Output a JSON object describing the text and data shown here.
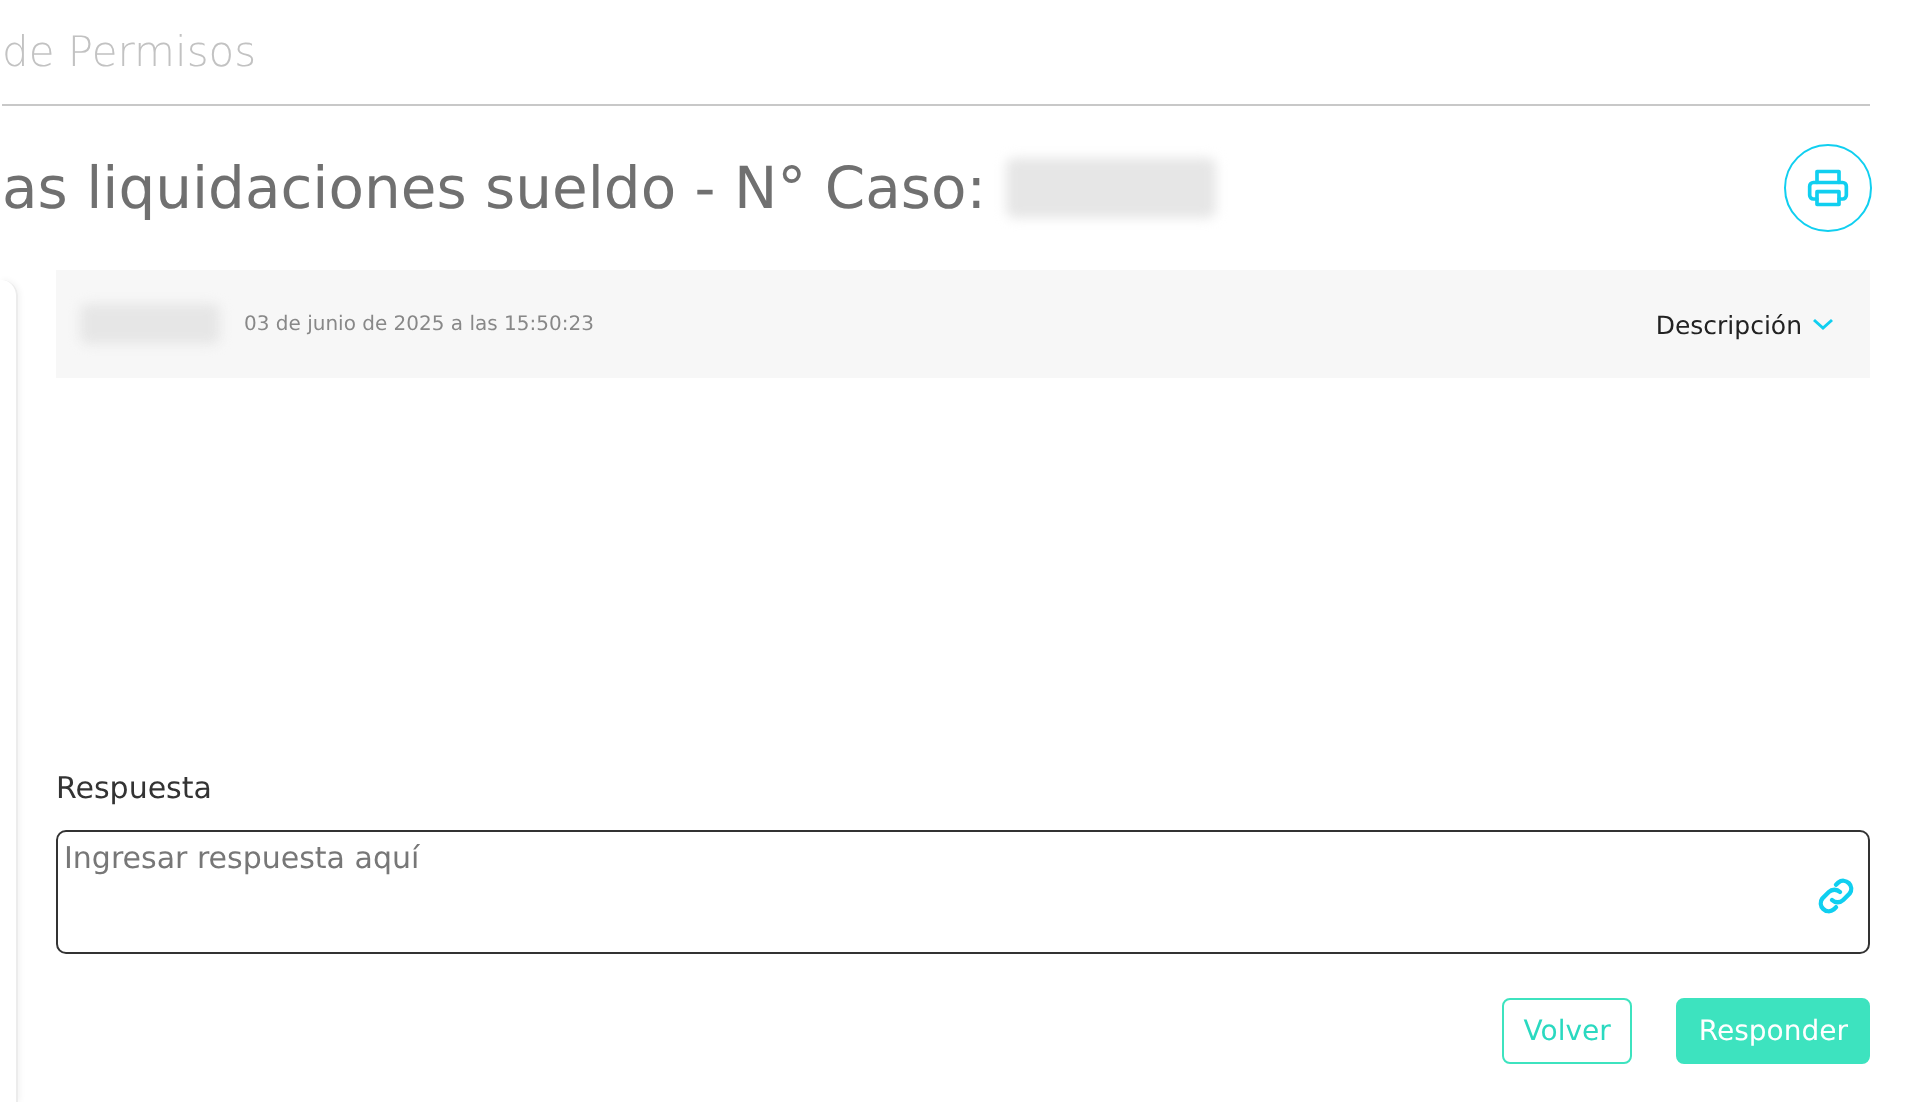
{
  "breadcrumb": "de Permisos",
  "title": "as liquidaciones sueldo - N° Caso:",
  "message": {
    "date": "03 de junio de 2025 a las 15:50:23",
    "toggle": "Descripción",
    "expanded": false
  },
  "reply": {
    "label": "Respuesta",
    "placeholder": "Ingresar respuesta aquí"
  },
  "buttons": [
    {
      "label": "Volver",
      "kind": "outline"
    },
    {
      "label": "Responder",
      "kind": "solid"
    }
  ]
}
